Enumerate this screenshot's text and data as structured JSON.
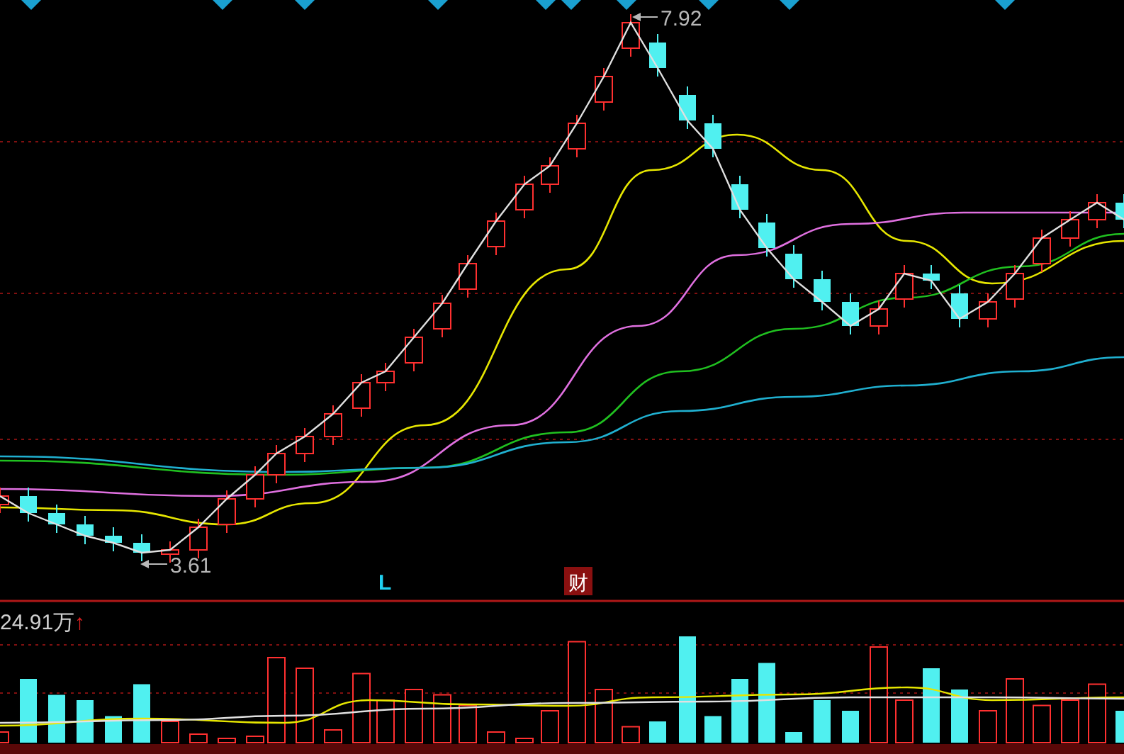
{
  "main_chart": {
    "high_label": "7.92",
    "low_label": "3.61",
    "markers": [
      {
        "kind": "letter",
        "text": "L"
      },
      {
        "kind": "badge",
        "text": "财"
      }
    ]
  },
  "volume_panel": {
    "reading": "24.91万",
    "arrow": "↑"
  }
}
